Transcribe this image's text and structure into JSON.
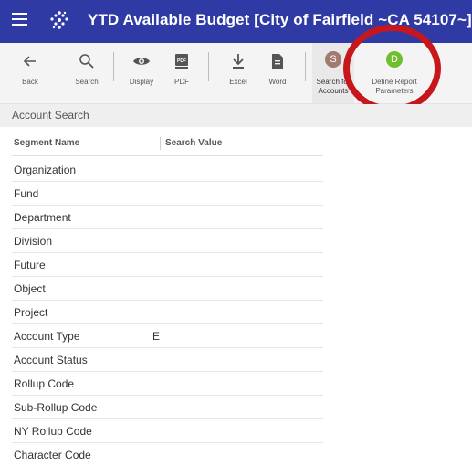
{
  "header": {
    "title": "YTD Available Budget [City of Fairfield ~CA 54107~]"
  },
  "toolbar": {
    "back": "Back",
    "search": "Search",
    "display": "Display",
    "pdf": "PDF",
    "excel": "Excel",
    "word": "Word",
    "search_accounts_letter": "S",
    "search_accounts_line1": "Search for",
    "search_accounts_line2": "Accounts",
    "define_letter": "D",
    "define_line1": "Define Report",
    "define_line2": "Parameters"
  },
  "section": {
    "title": "Account Search"
  },
  "table": {
    "col_segment": "Segment Name",
    "col_value": "Search Value",
    "rows": [
      {
        "name": "Organization",
        "value": ""
      },
      {
        "name": "Fund",
        "value": ""
      },
      {
        "name": "Department",
        "value": ""
      },
      {
        "name": "Division",
        "value": ""
      },
      {
        "name": "Future",
        "value": ""
      },
      {
        "name": "Object",
        "value": ""
      },
      {
        "name": "Project",
        "value": ""
      },
      {
        "name": "Account Type",
        "value": "E"
      },
      {
        "name": "Account Status",
        "value": ""
      },
      {
        "name": "Rollup Code",
        "value": ""
      },
      {
        "name": "Sub-Rollup Code",
        "value": ""
      },
      {
        "name": "NY Rollup Code",
        "value": ""
      },
      {
        "name": "Character Code",
        "value": ""
      }
    ]
  },
  "colors": {
    "header_bg": "#2f3aa5",
    "search_accounts_circle": "#a07b6e",
    "define_circle": "#6fbf2d",
    "annotation_ring": "#c8161d"
  }
}
